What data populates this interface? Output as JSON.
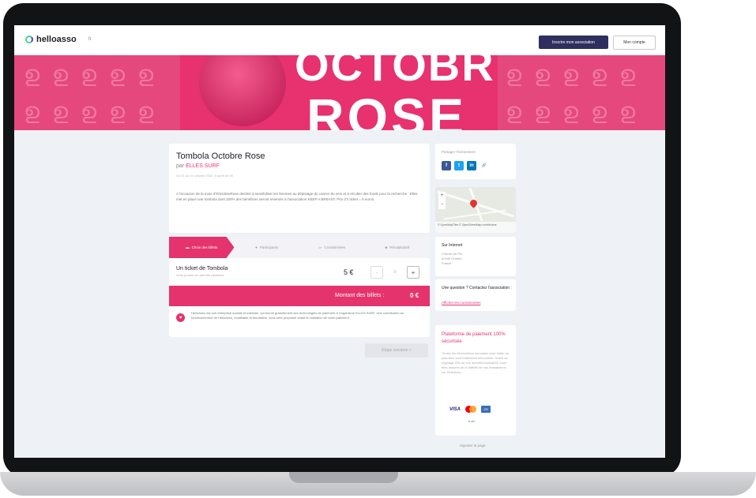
{
  "header": {
    "logo_text": "helloasso",
    "lang": "fr",
    "register_button": "Inscrire mon association",
    "account_button": "Mon compte"
  },
  "banner": {
    "word_top": "OCTOBRE",
    "word_bottom": "ROSE"
  },
  "event": {
    "title": "Tombola Octobre Rose",
    "by_prefix": "par",
    "organizer": "ELLES SURF",
    "date": "Du 01 au 31 octobre 2022, à partir de 8h",
    "description": "A l'occasion de la mois d'#OctobreRose destiné à sensibiliser les femmes au dépistage du cancer du sein et à récolter des fonds pour la recherche : Elles met en place une tombola dont 100% des bénéfices seront reversés à l'association KEEP A BREAST. Prix d'1 ticket = 5 euros."
  },
  "steps": {
    "tabs": [
      {
        "label": "Choix des billets",
        "icon": "ticket-icon",
        "active": true
      },
      {
        "label": "Participants",
        "icon": "user-icon",
        "active": false
      },
      {
        "label": "Coordonnées",
        "icon": "id-card-icon",
        "active": false
      },
      {
        "label": "Récapitulatif",
        "icon": "cart-icon",
        "active": false
      }
    ]
  },
  "ticket": {
    "name": "Un ticket de Tombola",
    "subtitle": "Vous pouvez en prendre plusieurs",
    "price": "5 €",
    "minus": "-",
    "quantity": "0",
    "plus": "+"
  },
  "total": {
    "label": "Montant des billets :",
    "value": "0 €"
  },
  "info": {
    "text": "HelloAsso est une entreprise sociale et solidaire, qui fournit gratuitement ses technologies de paiement à l'organisme ELLES SURF. Une contribution au fonctionnement de HelloAsso, modifiable et facultative, vous sera proposée avant la validation de votre paiement."
  },
  "next_button": "Étape suivante  >",
  "share": {
    "title": "Partager l'événement",
    "buttons": [
      {
        "label": "f",
        "icon": "facebook-icon",
        "color": "#3b5998"
      },
      {
        "label": "t",
        "icon": "twitter-icon",
        "color": "#1da1f2"
      },
      {
        "label": "in",
        "icon": "linkedin-icon",
        "color": "#0077b5"
      },
      {
        "label": "🔗",
        "icon": "link-icon",
        "color": "#ffffff"
      }
    ]
  },
  "map": {
    "attribution": "© OpenMapTiles © OpenStreetMap contributors",
    "zoom_in": "+",
    "zoom_out": "−"
  },
  "web": {
    "title": "Sur Internet",
    "lines": [
      "Chemin du Pic",
      "40440 Ondres",
      "France"
    ]
  },
  "question": {
    "title": "Une question ? Contactez l'association :",
    "link": "Afficher les coordonnées"
  },
  "secure": {
    "title": "Plateforme de paiement 100% sécurisée",
    "text": "Toutes les informations bancaires pour traiter ce paiement sont totalement sécurisées. Grâce au cryptage SSL de vos données bancaires, vous êtes assurés de la fiabilité de vos transactions sur HelloAsso.",
    "visa": "VISA",
    "cb": "CB",
    "other": "e-cb"
  },
  "report_link": "Signaler la page",
  "colors": {
    "brand_pink": "#e5336d",
    "navy": "#2e2f5e",
    "banner_pink": "#e5487d"
  }
}
